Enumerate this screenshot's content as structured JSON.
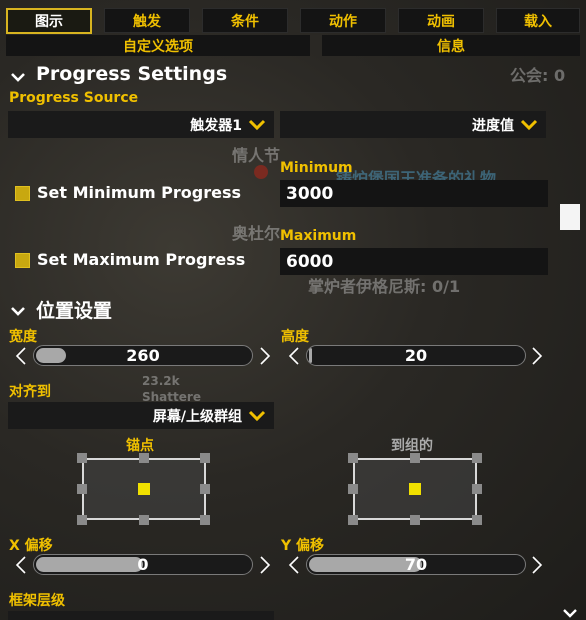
{
  "tabs": [
    "图示",
    "触发",
    "条件",
    "动作",
    "动画",
    "载入"
  ],
  "subtabs": [
    "自定义选项",
    "信息"
  ],
  "background_text": {
    "guild": "公会: 0",
    "npc1": "情人节",
    "quest": "铸炉堡国王准备的礼物",
    "npc2": "奥杜尔",
    "progress": "掌炉者伊格尼斯: 0/1",
    "nameplate1": "23.2k",
    "nameplate2": "Shattere"
  },
  "progress_settings": {
    "title": "Progress Settings",
    "source_label": "Progress Source",
    "source_trigger": "触发器1",
    "source_value": "进度值",
    "min_checkbox_label": "Set Minimum Progress",
    "min_label": "Minimum",
    "min_value": "3000",
    "max_checkbox_label": "Set Maximum Progress",
    "max_label": "Maximum",
    "max_value": "6000"
  },
  "position": {
    "title": "位置设置",
    "width_label": "宽度",
    "width_value": "260",
    "width_fill": 0.14,
    "height_label": "高度",
    "height_value": "20",
    "height_fill": 0.01,
    "align_label": "对齐到",
    "align_value": "屏幕/上级群组",
    "anchor_label": "锚点",
    "to_group_label": "到组的",
    "x_label": "X 偏移",
    "x_value": "0",
    "x_fill": 0.5,
    "y_label": "Y 偏移",
    "y_value": "70",
    "y_fill": 0.53,
    "frame_label": "框架层级"
  }
}
